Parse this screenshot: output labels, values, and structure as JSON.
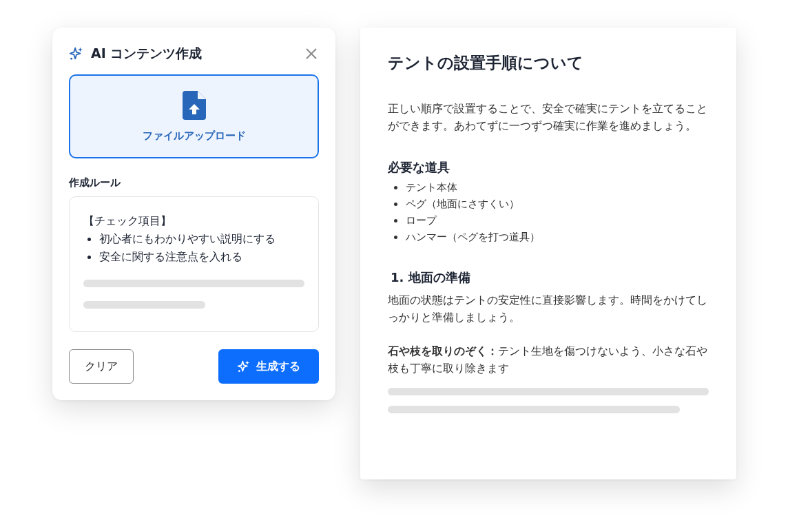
{
  "dialog": {
    "title": "AI コンテンツ作成",
    "upload": {
      "label": "ファイルアップロード"
    },
    "rules": {
      "label": "作成ルール",
      "heading": "【チェック項目】",
      "items": [
        "初心者にもわかりやすい説明にする",
        "安全に関する注意点を入れる"
      ]
    },
    "buttons": [
      {
        "label": "クリア",
        "kind": "secondary"
      },
      {
        "label": "生成する",
        "kind": "primary"
      }
    ]
  },
  "document": {
    "title": "テントの設置手順について",
    "intro": "正しい順序で設置することで、安全で確実にテントを立てることができます。あわてずに一つずつ確実に作業を進めましょう。",
    "sections": [
      {
        "kind": "list",
        "heading": "必要な道具",
        "items": [
          "テント本体",
          "ペグ（地面にさすくい）",
          "ロープ",
          "ハンマー（ペグを打つ道具）"
        ]
      },
      {
        "kind": "step",
        "heading": "1. 地面の準備",
        "body": " 地面の状態はテントの安定性に直接影響します。時間をかけてしっかりと準備しましょう。",
        "note": "**石や枝を取りのぞく：**テント生地を傷つけないよう、小さな石や枝も丁寧に取り除きます"
      }
    ]
  }
}
